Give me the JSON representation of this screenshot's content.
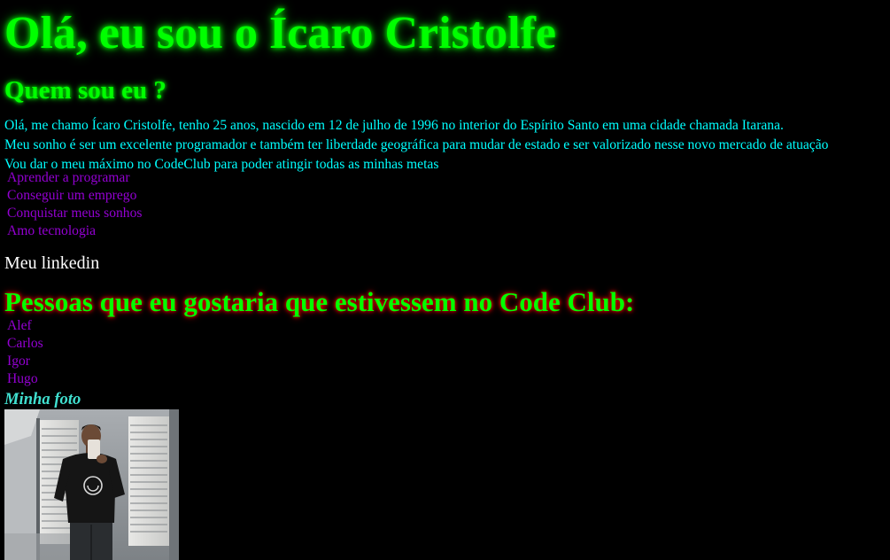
{
  "header": {
    "title": "Olá, eu sou o Ícaro Cristolfe"
  },
  "about": {
    "heading": "Quem sou eu ?",
    "paragraphs": [
      "Olá, me chamo Ícaro Cristolfe, tenho 25 anos, nascido em 12 de julho de 1996 no interior do Espírito Santo em uma cidade chamada Itarana.",
      "Meu sonho é ser um excelente programador e também ter liberdade geográfica para mudar de estado e ser valorizado nesse novo mercado de atuação",
      "Vou dar o meu máximo no CodeClub para poder atingir todas as minhas metas"
    ],
    "goals": [
      "Aprender a programar",
      "Conseguir um emprego",
      "Conquistar meus sonhos",
      "Amo tecnologia"
    ]
  },
  "links": {
    "linkedin_label": "Meu linkedin"
  },
  "people": {
    "heading": "Pessoas que eu gostaria que estivessem no Code Club:",
    "names": [
      "Alef",
      "Carlos",
      "Igor",
      "Hugo"
    ]
  },
  "photo": {
    "caption": "Minha foto"
  },
  "colors": {
    "background": "#000000",
    "title": "#00ff00",
    "bio_text": "#00ffff",
    "list_text": "#9400d3",
    "caption": "#40e0d0"
  }
}
